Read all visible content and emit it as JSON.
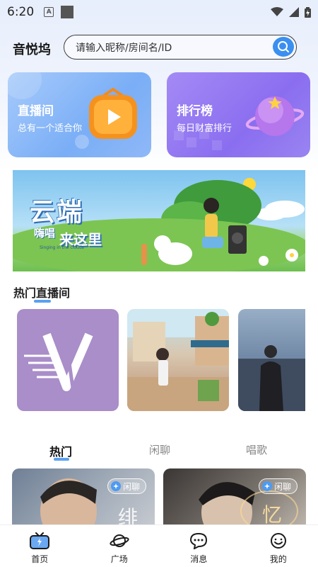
{
  "status": {
    "time": "6:20",
    "a_label": "A"
  },
  "header": {
    "title": "音悦坞",
    "search_placeholder": "请输入昵称/房间名/ID"
  },
  "cards": [
    {
      "title": "直播间",
      "subtitle": "总有一个适合你"
    },
    {
      "title": "排行榜",
      "subtitle": "每日财富排行"
    }
  ],
  "banner": {
    "line1": "云端",
    "line2a": "嗨唱",
    "line2b": "来这里",
    "small": "Singing in the clouds"
  },
  "section": {
    "title": "热门直播间"
  },
  "tabs": [
    "热门",
    "闲聊",
    "唱歌"
  ],
  "rooms": [
    {
      "tag": "闲聊",
      "char": "绯"
    },
    {
      "tag": "闲聊",
      "char": "忆"
    }
  ],
  "nav": [
    "首页",
    "广场",
    "消息",
    "我的"
  ],
  "colors": {
    "accent": "#3a8ff0",
    "live_card": "#7aaef6",
    "rank_card": "#8a6ef0"
  }
}
